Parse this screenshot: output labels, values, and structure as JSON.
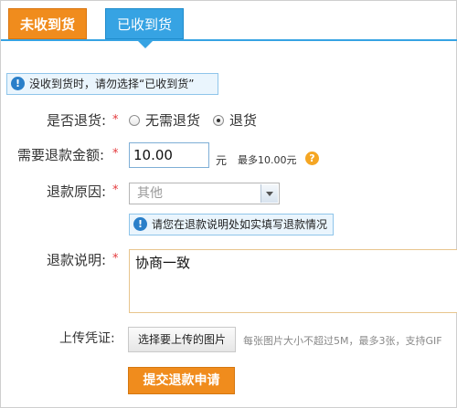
{
  "tabs": {
    "not_received": "未收到货",
    "received": "已收到货"
  },
  "notice": {
    "text": "没收到货时，请勿选择“已收到货”"
  },
  "form": {
    "return_label": "是否退货:",
    "return_options": {
      "no_return": "无需退货",
      "return": "退货"
    },
    "return_selected": "return",
    "amount_label": "需要退款金额:",
    "amount_value": "10.00",
    "amount_unit": "元",
    "amount_max": "最多10.00元",
    "reason_label": "退款原因:",
    "reason_value": "其他",
    "reason_hint": "请您在退款说明处如实填写退款情况",
    "desc_label": "退款说明:",
    "desc_value": "协商一致",
    "upload_label": "上传凭证:",
    "upload_button": "选择要上传的图片",
    "upload_note": "每张图片大小不超过5M，最多3张，支持GIF",
    "required_mark": "*",
    "submit": "提交退款申请"
  },
  "colors": {
    "orange": "#f08c1d",
    "blue": "#36a3e3",
    "required": "#e4393c"
  }
}
